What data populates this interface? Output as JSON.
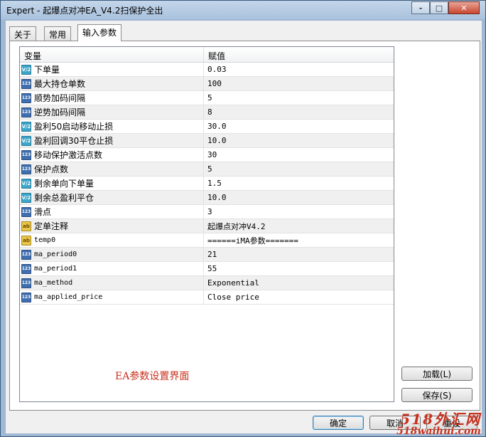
{
  "window": {
    "title": "Expert - 起爆点对冲EA_V4.2扫保护全出",
    "controls": [
      "-",
      "□",
      "✕"
    ]
  },
  "tabs": [
    {
      "label": "关于",
      "active": false
    },
    {
      "label": "常用",
      "active": false
    },
    {
      "label": "输入参数",
      "active": true
    }
  ],
  "grid": {
    "columns": [
      "变量",
      "赋值"
    ],
    "rows": [
      {
        "type": "double",
        "icon": "V/2",
        "name": "下单量",
        "value": "0.03"
      },
      {
        "type": "int",
        "icon": "123",
        "name": "最大持仓单数",
        "value": "100"
      },
      {
        "type": "int",
        "icon": "123",
        "name": "顺势加码间隔",
        "value": "5"
      },
      {
        "type": "int",
        "icon": "123",
        "name": "逆势加码间隔",
        "value": "8"
      },
      {
        "type": "double",
        "icon": "V/2",
        "name": "盈利50启动移动止损",
        "value": "30.0"
      },
      {
        "type": "double",
        "icon": "V/2",
        "name": "盈利回调30平仓止损",
        "value": "10.0"
      },
      {
        "type": "int",
        "icon": "123",
        "name": "移动保护激活点数",
        "value": "30"
      },
      {
        "type": "int",
        "icon": "123",
        "name": "保护点数",
        "value": "5"
      },
      {
        "type": "double",
        "icon": "V/2",
        "name": "剩余单向下单量",
        "value": "1.5"
      },
      {
        "type": "double",
        "icon": "V/2",
        "name": "剩余总盈利平仓",
        "value": "10.0"
      },
      {
        "type": "int",
        "icon": "123",
        "name": "滑点",
        "value": "3"
      },
      {
        "type": "string",
        "icon": "ab",
        "name": "定单注释",
        "value": "起爆点对冲V4.2"
      },
      {
        "type": "string",
        "icon": "ab",
        "name": "temp0",
        "value": "======iMA参数======="
      },
      {
        "type": "int",
        "icon": "123",
        "name": "ma_period0",
        "value": "21"
      },
      {
        "type": "int",
        "icon": "123",
        "name": "ma_period1",
        "value": "55"
      },
      {
        "type": "int",
        "icon": "123",
        "name": "ma_method",
        "value": "Exponential"
      },
      {
        "type": "int",
        "icon": "123",
        "name": "ma_applied_price",
        "value": "Close price"
      }
    ]
  },
  "caption": "EA参数设置界面",
  "buttons": {
    "load": "加载(L)",
    "save": "保存(S)",
    "ok": "确定",
    "cancel": "取消",
    "reset": "重设"
  },
  "watermark": {
    "line1": "518外汇网",
    "line2": "518waihui.com"
  }
}
